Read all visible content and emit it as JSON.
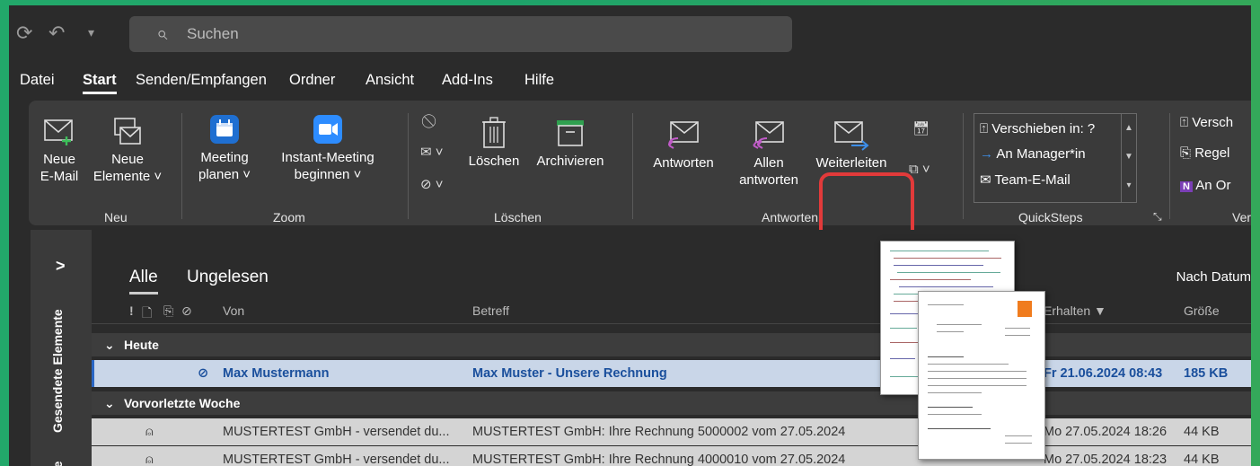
{
  "titlebar": {
    "search_placeholder": "Suchen"
  },
  "menu": {
    "tabs": [
      "Datei",
      "Start",
      "Senden/Empfangen",
      "Ordner",
      "Ansicht",
      "Add-Ins",
      "Hilfe"
    ],
    "active": "Start"
  },
  "ribbon": {
    "neu": {
      "neue_email": [
        "Neue",
        "E-Mail"
      ],
      "neue_elemente": [
        "Neue",
        "Elemente ˅"
      ],
      "group": "Neu"
    },
    "zoom": {
      "meeting": [
        "Meeting",
        "planen ˅"
      ],
      "instant": [
        "Instant-Meeting",
        "beginnen ˅"
      ],
      "group": "Zoom"
    },
    "loeschen": {
      "loeschen": "Löschen",
      "archivieren": "Archivieren",
      "group": "Löschen"
    },
    "antworten": {
      "antworten": "Antworten",
      "allen": [
        "Allen",
        "antworten"
      ],
      "weiterleiten": "Weiterleiten",
      "group": "Antworten"
    },
    "quicksteps": {
      "items": [
        "Verschieben in: ?",
        "An Manager*in",
        "Team-E-Mail"
      ],
      "group": "QuickSteps"
    },
    "verschieben": {
      "items": [
        "Versch",
        "Regel",
        "An Or"
      ],
      "group": "Ver"
    }
  },
  "sidebar": {
    "label_sent": "Gesendete Elemente",
    "label_partial": "te"
  },
  "list": {
    "filters": [
      "Alle",
      "Ungelesen"
    ],
    "sort": "Nach Datum",
    "columns": {
      "von": "Von",
      "betreff": "Betreff",
      "erhalten": "Erhalten ▼",
      "groesse": "Größe"
    },
    "groups": [
      {
        "label": "Heute",
        "rows": [
          {
            "from": "Max Mustermann",
            "subject": "Max Muster - Unsere Rechnung",
            "received": "Fr 21.06.2024 08:43",
            "size": "185 KB"
          }
        ]
      },
      {
        "label": "Vorvorletzte Woche",
        "rows": [
          {
            "from": "MUSTERTEST GmbH - versendet du...",
            "subject": "MUSTERTEST GmbH: Ihre Rechnung 5000002 vom 27.05.2024",
            "received": "Mo 27.05.2024 18:26",
            "size": "44 KB"
          },
          {
            "from": "MUSTERTEST GmbH - versendet du...",
            "subject": "MUSTERTEST GmbH: Ihre Rechnung 4000010 vom 27.05.2024",
            "received": "Mo 27.05.2024 18:23",
            "size": "44 KB"
          }
        ]
      }
    ]
  },
  "colors": {
    "accent": "#2a66c4",
    "highlight": "#e23a3a",
    "zoom_blue": "#2d8cff",
    "meeting_blue": "#1f6fd1"
  }
}
